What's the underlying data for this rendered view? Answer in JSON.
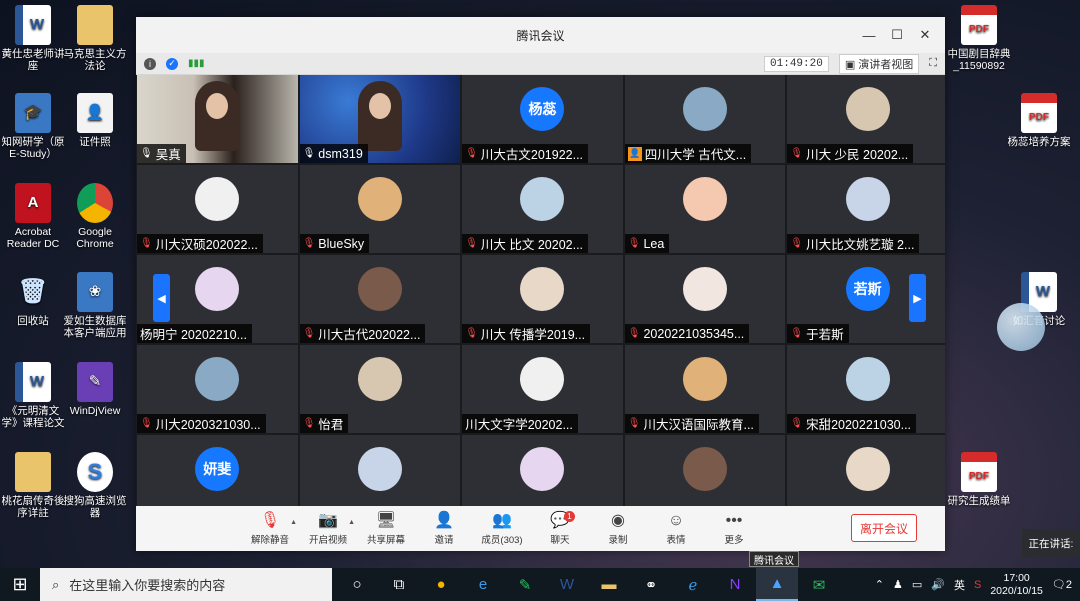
{
  "desktop": {
    "left_icons": [
      {
        "label": "黄仕忠老师讲座",
        "type": "word",
        "glyph": "W"
      },
      {
        "label": "马克思主义方法论",
        "type": "folder",
        "glyph": ""
      },
      {
        "label": "知网研学（原E-Study）",
        "type": "app",
        "glyph": "🎓"
      },
      {
        "label": "证件照",
        "type": "person",
        "glyph": "👤"
      },
      {
        "label": "Acrobat Reader DC",
        "type": "acro",
        "glyph": "A"
      },
      {
        "label": "Google Chrome",
        "type": "chrome",
        "glyph": ""
      },
      {
        "label": "回收站",
        "type": "recycle",
        "glyph": "🗑"
      },
      {
        "label": "爱如生数据库 本客户端应用",
        "type": "app",
        "glyph": "❀"
      },
      {
        "label": "《元明清文学》课程论文",
        "type": "word",
        "glyph": "W"
      },
      {
        "label": "WinDjView",
        "type": "win",
        "glyph": "✎"
      },
      {
        "label": "桃花扇传奇後序详註",
        "type": "folder",
        "glyph": ""
      },
      {
        "label": "搜狗高速浏览器",
        "type": "sogou",
        "glyph": "S"
      }
    ],
    "right_icons": [
      {
        "label": "中国剧目辞典_11590892",
        "type": "pdf",
        "glyph": "PDF"
      },
      {
        "label": "杨蕊培养方案",
        "type": "pdf",
        "glyph": "PDF"
      },
      {
        "label": "如汇音讨论",
        "type": "word",
        "glyph": "W"
      },
      {
        "label": "研究生成绩单",
        "type": "pdf",
        "glyph": "PDF"
      }
    ]
  },
  "meeting": {
    "title": "腾讯会议",
    "timer": "01:49:20",
    "speaker_view_label": "演讲者视图",
    "participants": [
      {
        "name": "吴真",
        "kind": "video1",
        "mic": "on"
      },
      {
        "name": "dsm319",
        "kind": "video2",
        "mic": "on"
      },
      {
        "name": "川大古文201922...",
        "kind": "avatar-text",
        "avatar_text": "杨蕊",
        "mic": "muted"
      },
      {
        "name": "四川大学 古代文...",
        "kind": "avatar",
        "mic": "share"
      },
      {
        "name": "川大 少民 20202...",
        "kind": "avatar",
        "mic": "muted"
      },
      {
        "name": "川大汉硕202022...",
        "kind": "avatar",
        "mic": "muted"
      },
      {
        "name": "BlueSky",
        "kind": "avatar",
        "mic": "muted"
      },
      {
        "name": "川大 比文 20202...",
        "kind": "avatar",
        "mic": "muted"
      },
      {
        "name": "Lea",
        "kind": "avatar",
        "mic": "muted"
      },
      {
        "name": "川大比文姚艺璇 2...",
        "kind": "avatar",
        "mic": "muted"
      },
      {
        "name": "杨明宁 20202210...",
        "kind": "avatar",
        "mic": "none"
      },
      {
        "name": "川大古代202022...",
        "kind": "avatar",
        "mic": "muted"
      },
      {
        "name": "川大 传播学2019...",
        "kind": "avatar",
        "mic": "muted"
      },
      {
        "name": "2020221035345...",
        "kind": "avatar",
        "mic": "muted"
      },
      {
        "name": "于若斯",
        "kind": "avatar-text",
        "avatar_text": "若斯",
        "mic": "muted"
      },
      {
        "name": "川大2020321030...",
        "kind": "avatar",
        "mic": "muted"
      },
      {
        "name": "怡君",
        "kind": "avatar",
        "mic": "muted"
      },
      {
        "name": "川大文字学20202...",
        "kind": "avatar",
        "mic": "none"
      },
      {
        "name": "川大汉语国际教育...",
        "kind": "avatar",
        "mic": "muted"
      },
      {
        "name": "宋甜2020221030...",
        "kind": "avatar",
        "mic": "muted"
      },
      {
        "name": "",
        "kind": "avatar-text",
        "avatar_text": "妍斐",
        "mic": "none"
      },
      {
        "name": "",
        "kind": "avatar",
        "mic": "none"
      },
      {
        "name": "",
        "kind": "avatar",
        "mic": "none"
      },
      {
        "name": "",
        "kind": "avatar",
        "mic": "none"
      },
      {
        "name": "",
        "kind": "avatar",
        "mic": "none"
      }
    ],
    "toolbar": {
      "unmute": "解除静音",
      "start_video": "开启视频",
      "share_screen": "共享屏幕",
      "invite": "邀请",
      "members": "成员(303)",
      "chat": "聊天",
      "chat_badge": "1",
      "record": "录制",
      "reactions": "表情",
      "more": "更多",
      "leave": "离开会议"
    }
  },
  "taskbar": {
    "search_placeholder": "在这里输入你要搜索的内容",
    "time": "17:00",
    "date": "2020/10/15",
    "ime": "英",
    "tooltip": "腾讯会议",
    "speaking_label": "正在讲话:",
    "notify_count": "2"
  }
}
